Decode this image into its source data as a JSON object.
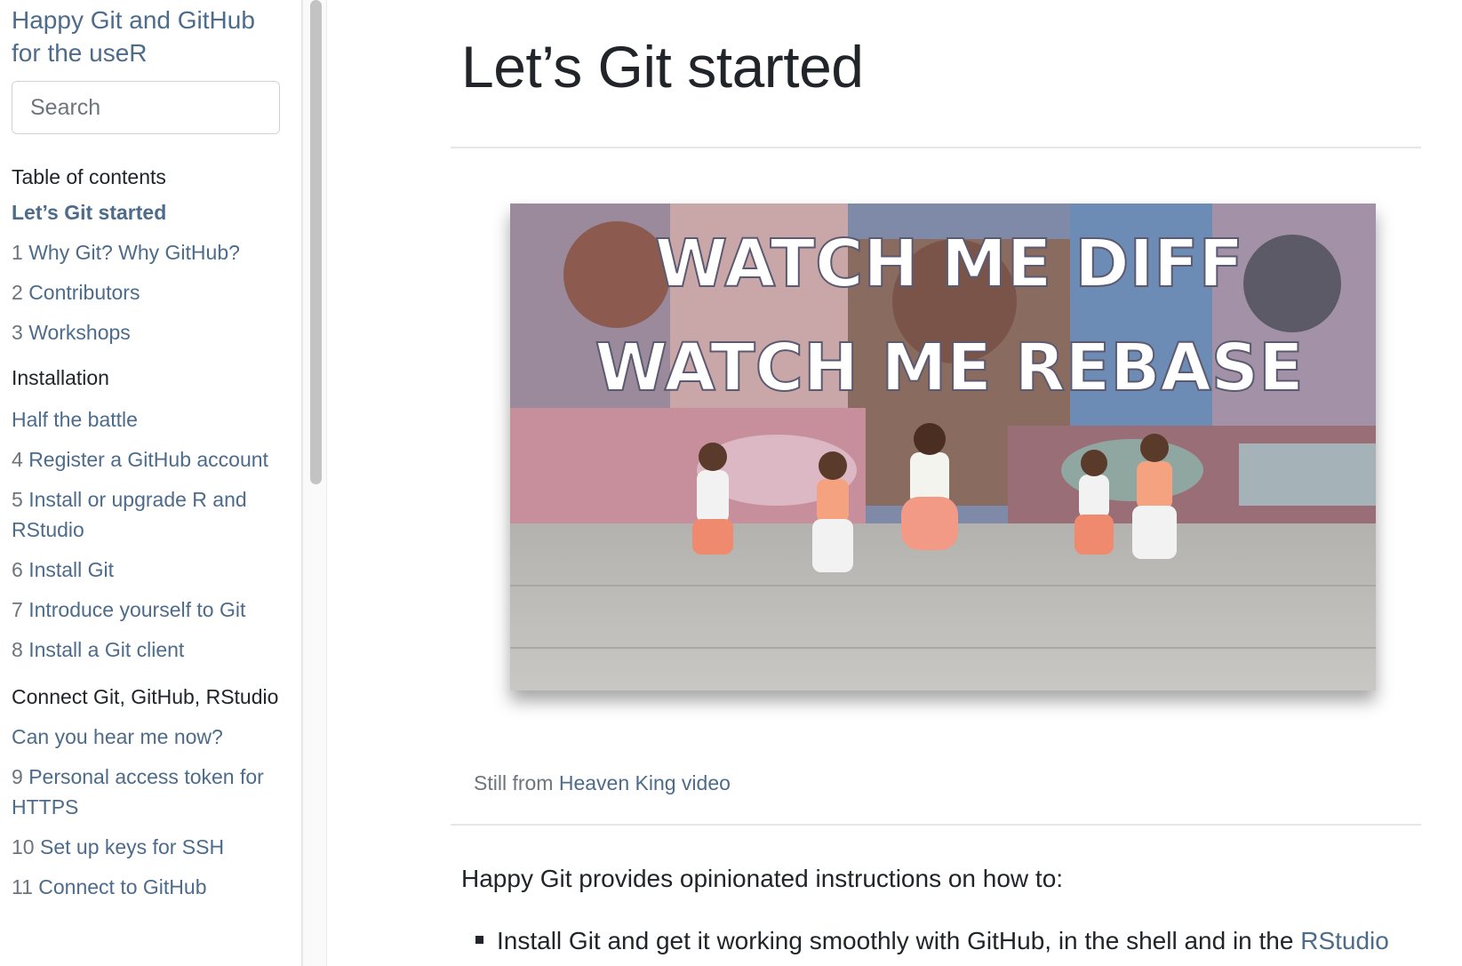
{
  "sidebar": {
    "title": "Happy Git and GitHub for the useR",
    "search_placeholder": "Search",
    "toc_heading": "Table of contents",
    "items": [
      {
        "label": "Let’s Git started"
      },
      {
        "num": "1",
        "label": "Why Git? Why GitHub?"
      },
      {
        "num": "2",
        "label": "Contributors"
      },
      {
        "num": "3",
        "label": "Workshops"
      },
      {
        "section": "Installation"
      },
      {
        "label": "Half the battle"
      },
      {
        "num": "4",
        "label": "Register a GitHub account"
      },
      {
        "num": "5",
        "label": "Install or upgrade R and RStudio"
      },
      {
        "num": "6",
        "label": "Install Git"
      },
      {
        "num": "7",
        "label": "Introduce yourself to Git"
      },
      {
        "num": "8",
        "label": "Install a Git client"
      },
      {
        "section": "Connect Git, GitHub, RStudio"
      },
      {
        "label": "Can you hear me now?"
      },
      {
        "num": "9",
        "label": "Personal access token for HTTPS"
      },
      {
        "num": "10",
        "label": "Set up keys for SSH"
      },
      {
        "num": "11",
        "label": "Connect to GitHub"
      }
    ]
  },
  "main": {
    "title": "Let’s Git started",
    "figure": {
      "overlay_line1": "WATCH ME DIFF",
      "overlay_line2": "WATCH ME REBASE",
      "caption_prefix": "Still from",
      "caption_link": "Heaven King video"
    },
    "intro": "Happy Git provides opinionated instructions on how to:",
    "bullet1_text": "Install Git and get it working smoothly with GitHub, in the shell and in the",
    "bullet1_link": "RStudio"
  },
  "colors": {
    "link": "#4d6b8a",
    "text": "#212529",
    "muted": "#6c757d"
  }
}
